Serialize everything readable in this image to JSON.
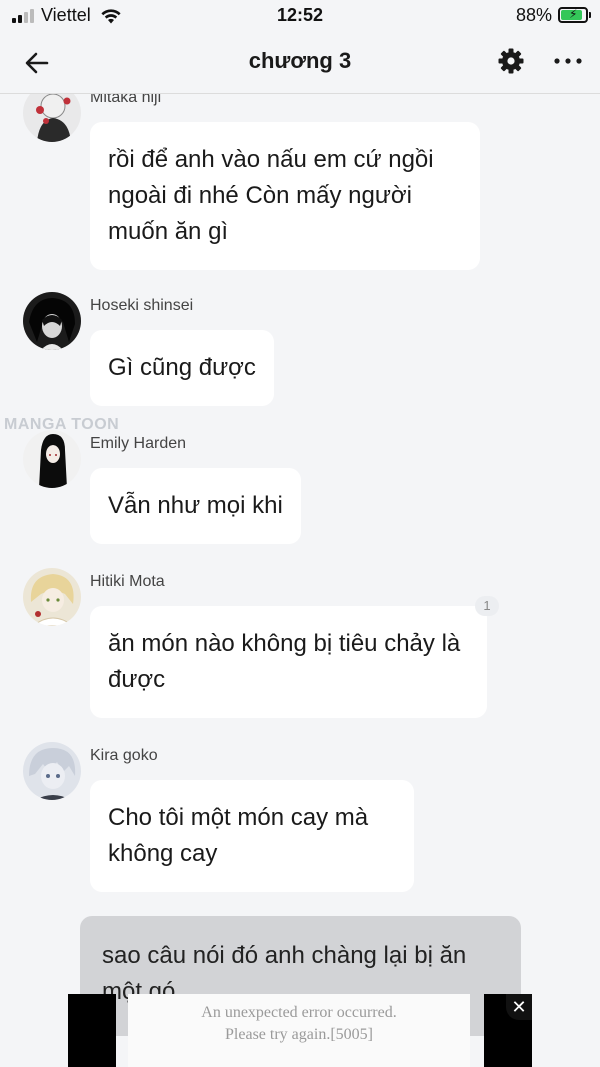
{
  "status_bar": {
    "carrier": "Viettel",
    "time": "12:52",
    "battery_percent": "88%",
    "battery_level": 0.88
  },
  "header": {
    "title": "chương 3"
  },
  "watermark": "MANGA TOON",
  "messages": [
    {
      "name": "Mitaka hiji",
      "text": "rồi để anh vào nấu em cứ ngồi ngoài đi nhé Còn mấy người muốn ăn gì"
    },
    {
      "name": "Hoseki shinsei",
      "text": "Gì cũng được"
    },
    {
      "name": "Emily Harden",
      "text": "Vẫn như mọi khi"
    },
    {
      "name": "Hitiki Mota",
      "text": "ăn món nào không bị tiêu chảy là được",
      "badge": "1"
    },
    {
      "name": "Kira goko",
      "text": "Cho tôi một món cay mà không cay"
    }
  ],
  "narration": {
    "text": "sao câu nói đó anh chàng lại bị ăn một gó"
  },
  "ad": {
    "line1": "An unexpected error occurred.",
    "line2": "Please try again.[5005]",
    "close": "✕"
  }
}
